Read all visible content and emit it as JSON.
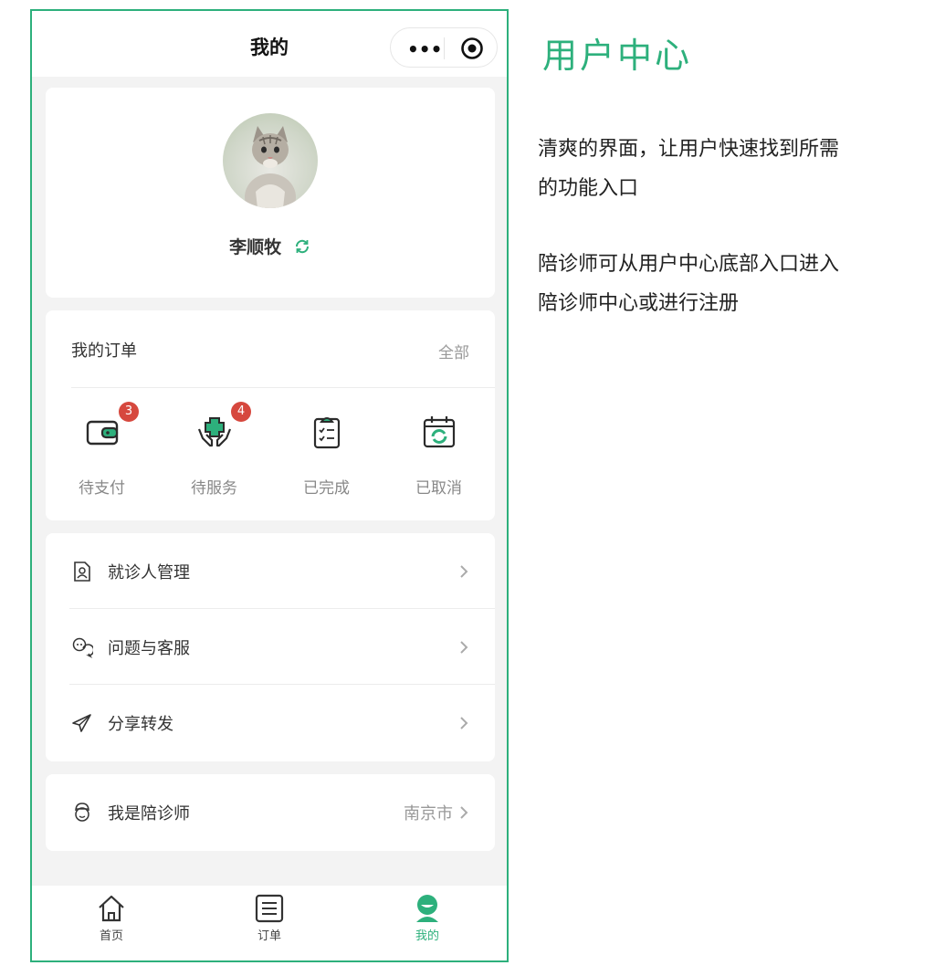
{
  "colors": {
    "accent": "#2db07c",
    "badge": "#d6483e",
    "muted": "#999999"
  },
  "nav": {
    "title": "我的"
  },
  "profile": {
    "name": "李顺牧"
  },
  "orders": {
    "title": "我的订单",
    "all_label": "全部",
    "items": [
      {
        "label": "待支付",
        "badge": "3",
        "icon": "wallet-icon"
      },
      {
        "label": "待服务",
        "badge": "4",
        "icon": "care-hands-icon"
      },
      {
        "label": "已完成",
        "badge": "",
        "icon": "clipboard-check-icon"
      },
      {
        "label": "已取消",
        "badge": "",
        "icon": "calendar-refresh-icon"
      }
    ]
  },
  "menu": {
    "items": [
      {
        "label": "就诊人管理",
        "icon": "patient-file-icon"
      },
      {
        "label": "问题与客服",
        "icon": "customer-service-icon"
      },
      {
        "label": "分享转发",
        "icon": "share-icon"
      }
    ]
  },
  "escort": {
    "label": "我是陪诊师",
    "city": "南京市",
    "icon": "nurse-icon"
  },
  "tabbar": {
    "items": [
      {
        "label": "首页",
        "icon": "home-icon"
      },
      {
        "label": "订单",
        "icon": "list-icon"
      },
      {
        "label": "我的",
        "icon": "user-icon",
        "active": true
      }
    ]
  },
  "description": {
    "title": "用户中心",
    "p1_line1": "清爽的界面，让用户快速找到所需",
    "p1_line2": "的功能入口",
    "p2_line1": "陪诊师可从用户中心底部入口进入",
    "p2_line2": "陪诊师中心或进行注册"
  }
}
